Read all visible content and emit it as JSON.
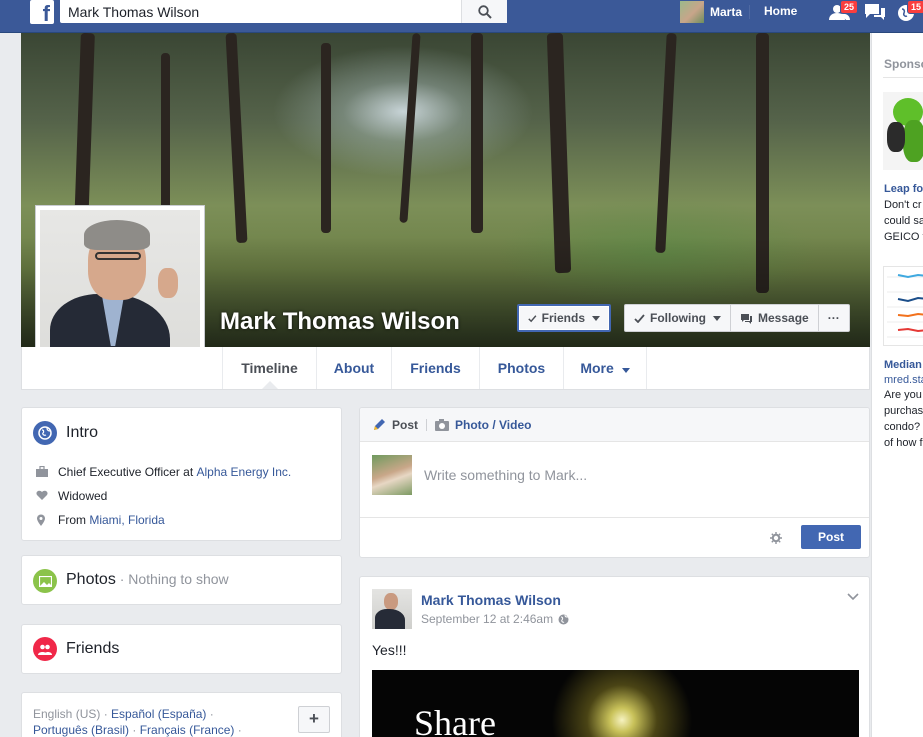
{
  "topbar": {
    "search_value": "Mark Thomas Wilson",
    "user_name": "Marta",
    "home_label": "Home",
    "friend_requests_count": "25",
    "notifications_count": "15"
  },
  "profile": {
    "name": "Mark Thomas Wilson",
    "friends_button": "Friends",
    "following_button": "Following",
    "message_button": "Message",
    "more_options": "···"
  },
  "tabs": [
    "Timeline",
    "About",
    "Friends",
    "Photos",
    "More"
  ],
  "intro": {
    "title": "Intro",
    "work_prefix": "Chief Executive Officer at ",
    "work_link": "Alpha Energy Inc.",
    "relationship": "Widowed",
    "from_prefix": "From ",
    "from_link": "Miami, Florida"
  },
  "photos": {
    "title": "Photos",
    "sep": " · ",
    "empty": "Nothing to show"
  },
  "friends_card": {
    "title": "Friends"
  },
  "languages": {
    "line1_a": "English (US)",
    "line1_b": "Español (España)",
    "line2_a": "Português (Brasil)",
    "line2_b": "Français (France)",
    "dot": " · ",
    "add": "+"
  },
  "composer": {
    "post_tab": "Post",
    "photo_tab": "Photo / Video",
    "placeholder": "Write something to Mark...",
    "post_button": "Post"
  },
  "feed_post": {
    "author": "Mark Thomas Wilson",
    "time": "September 12 at 2:46am",
    "text": "Yes!!!",
    "image_text": "Share"
  },
  "sidebar": {
    "heading": "Sponso",
    "ad1_title": "Leap fo",
    "ad1_line1": "Don't cr",
    "ad1_line2": "could sa",
    "ad1_line3": "GEICO t",
    "ad2_title": "Median",
    "ad2_site": "mred.sta",
    "ad2_line1": "Are you",
    "ad2_line2": "purchas",
    "ad2_line3": "condo?",
    "ad2_line4": "of how f"
  },
  "colors": {
    "brand": "#3b5998",
    "link": "#365899",
    "button": "#4267b2",
    "badge": "#fa3e3e"
  }
}
